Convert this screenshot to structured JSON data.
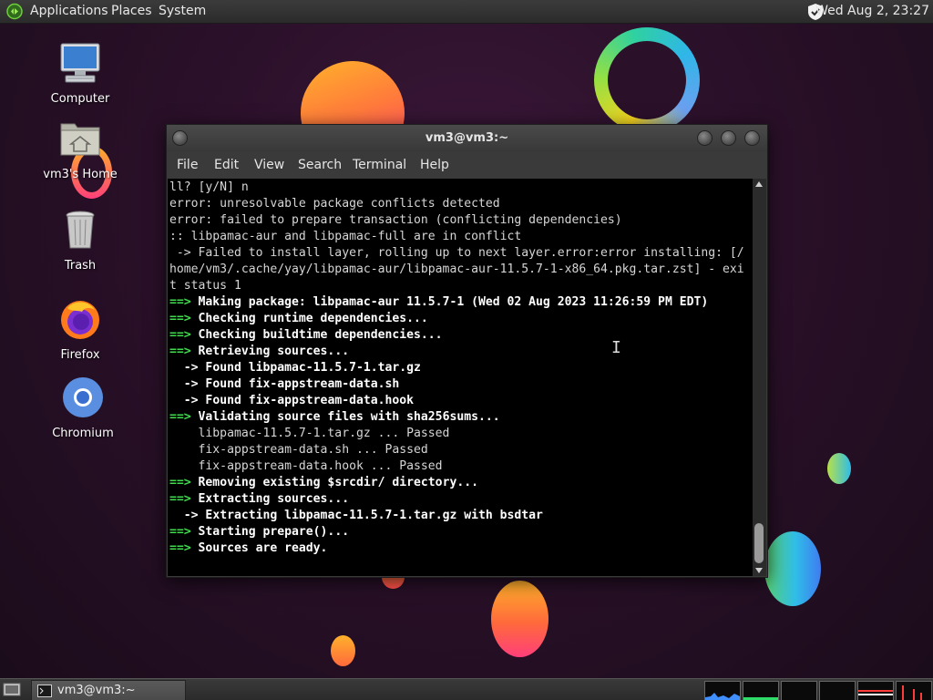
{
  "top_panel": {
    "menus": [
      "Applications",
      "Places",
      "System"
    ],
    "clock": "Wed Aug  2, 23:27"
  },
  "desktop": {
    "icons": [
      {
        "label": "Computer",
        "icon": "computer-icon"
      },
      {
        "label": "vm3's Home",
        "icon": "home-folder-icon"
      },
      {
        "label": "Trash",
        "icon": "trash-icon"
      },
      {
        "label": "Firefox",
        "icon": "firefox-icon"
      },
      {
        "label": "Chromium",
        "icon": "chromium-icon"
      }
    ]
  },
  "terminal": {
    "title": "vm3@vm3:~",
    "menu": [
      "File",
      "Edit",
      "View",
      "Search",
      "Terminal",
      "Help"
    ],
    "lines": [
      "ll? [y/N] n",
      "error: unresolvable package conflicts detected",
      "error: failed to prepare transaction (conflicting dependencies)",
      ":: libpamac-aur and libpamac-full are in conflict",
      " -> Failed to install layer, rolling up to next layer.error:error installing: [/",
      "home/vm3/.cache/yay/libpamac-aur/libpamac-aur-11.5.7-1-x86_64.pkg.tar.zst] - exi",
      "t status 1",
      "==> Making package: libpamac-aur 11.5.7-1 (Wed 02 Aug 2023 11:26:59 PM EDT)",
      "==> Checking runtime dependencies...",
      "==> Checking buildtime dependencies...",
      "==> Retrieving sources...",
      "  -> Found libpamac-11.5.7-1.tar.gz",
      "  -> Found fix-appstream-data.sh",
      "  -> Found fix-appstream-data.hook",
      "==> Validating source files with sha256sums...",
      "    libpamac-11.5.7-1.tar.gz ... Passed",
      "    fix-appstream-data.sh ... Passed",
      "    fix-appstream-data.hook ... Passed",
      "==> Removing existing $srcdir/ directory...",
      "==> Extracting sources...",
      "  -> Extracting libpamac-11.5.7-1.tar.gz with bsdtar",
      "==> Starting prepare()...",
      "==> Sources are ready."
    ]
  },
  "taskbar": {
    "tasks": [
      {
        "label": "vm3@vm3:~",
        "icon": "terminal-icon"
      }
    ]
  },
  "colors": {
    "arrow_green": "#3fdc4e",
    "terminal_bg": "#000000",
    "panel_bg": "#2b2b2b"
  }
}
